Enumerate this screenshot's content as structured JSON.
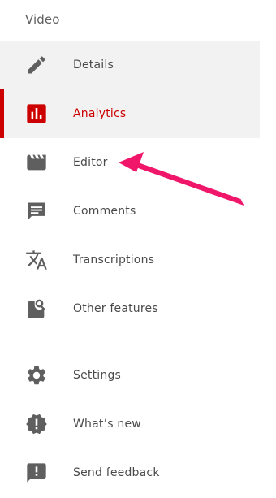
{
  "section_title": "Video",
  "nav_items": [
    {
      "label": "Details",
      "icon": "pencil-icon"
    },
    {
      "label": "Analytics",
      "icon": "analytics-icon",
      "active": true
    },
    {
      "label": "Editor",
      "icon": "clapperboard-icon"
    },
    {
      "label": "Comments",
      "icon": "comment-icon"
    },
    {
      "label": "Transcriptions",
      "icon": "translate-icon"
    },
    {
      "label": "Other features",
      "icon": "search-file-icon"
    }
  ],
  "bottom_items": [
    {
      "label": "Settings",
      "icon": "gear-icon"
    },
    {
      "label": "What’s new",
      "icon": "badge-alert-icon"
    },
    {
      "label": "Send feedback",
      "icon": "feedback-icon"
    }
  ],
  "colors": {
    "accent": "#cc0000",
    "icon_gray": "#5f5f5f",
    "annotation_arrow": "#f0176b",
    "highlight_bg": "#f2f2f2"
  }
}
